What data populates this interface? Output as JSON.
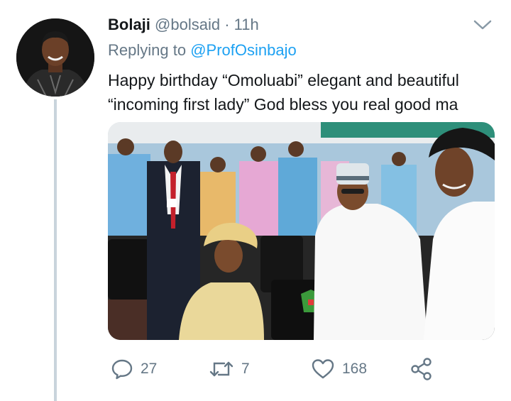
{
  "tweet": {
    "author_name": "Bolaji",
    "author_handle": "@bolsaid",
    "separator": "·",
    "time": "11h",
    "reply_prefix": "Replying to",
    "reply_to": "@ProfOsinbajo",
    "text": "Happy birthday “Omoluabi” elegant and beautiful “incoming first lady” God bless you real good ma"
  },
  "actions": {
    "reply_count": "27",
    "retweet_count": "7",
    "like_count": "168"
  },
  "icons": {
    "more": "chevron-down-icon",
    "reply": "comment-bubble-icon",
    "retweet": "retweet-arrows-icon",
    "like": "heart-icon",
    "share": "share-nodes-icon"
  },
  "colors": {
    "accent": "#1da1f2",
    "muted": "#657786",
    "text": "#14171a",
    "thread_line": "#c9d4dc"
  }
}
